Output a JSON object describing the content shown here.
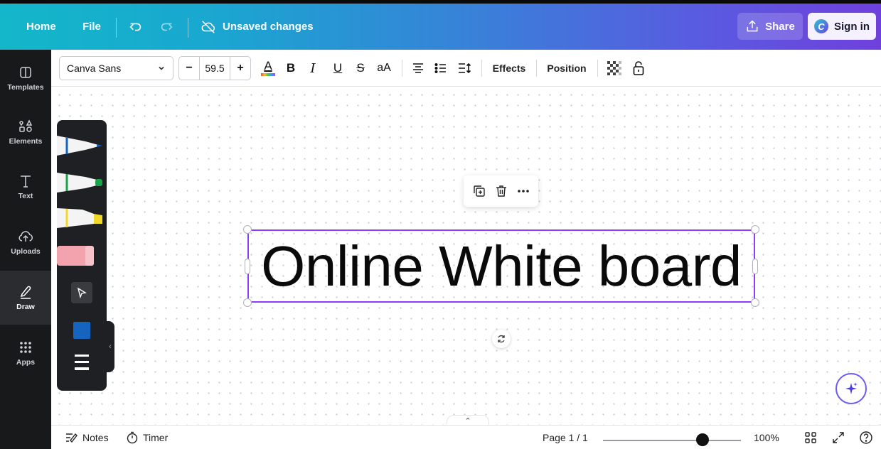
{
  "topbar": {
    "home": "Home",
    "file": "File",
    "status": "Unsaved changes",
    "share": "Share",
    "signin": "Sign in"
  },
  "sidebar": {
    "items": [
      {
        "label": "Templates",
        "icon": "templates-icon"
      },
      {
        "label": "Elements",
        "icon": "elements-icon"
      },
      {
        "label": "Text",
        "icon": "text-icon"
      },
      {
        "label": "Uploads",
        "icon": "uploads-icon"
      },
      {
        "label": "Draw",
        "icon": "draw-icon",
        "active": true
      },
      {
        "label": "Apps",
        "icon": "apps-icon"
      }
    ]
  },
  "toolbar": {
    "font": "Canva Sans",
    "size_minus": "−",
    "font_size": "59.5",
    "size_plus": "+",
    "text_color_letter": "A",
    "bold": "B",
    "italic": "I",
    "underline": "U",
    "strike": "S",
    "case": "aA",
    "effects": "Effects",
    "position": "Position"
  },
  "canvas": {
    "text": "Online White board"
  },
  "draw_panel": {
    "pens": [
      {
        "name": "pen",
        "color": "#1565c0"
      },
      {
        "name": "marker",
        "color": "#1aa34a"
      },
      {
        "name": "highlighter",
        "color": "#f0d92a"
      },
      {
        "name": "eraser",
        "color": "#f3a3ae"
      }
    ],
    "selected_color": "#1565c0"
  },
  "footer": {
    "notes": "Notes",
    "timer": "Timer",
    "page": "Page 1 / 1",
    "zoom": "100%",
    "zoom_level": 0.72
  },
  "colors": {
    "selection": "#8b3dff",
    "rail_bg": "#18191b"
  }
}
